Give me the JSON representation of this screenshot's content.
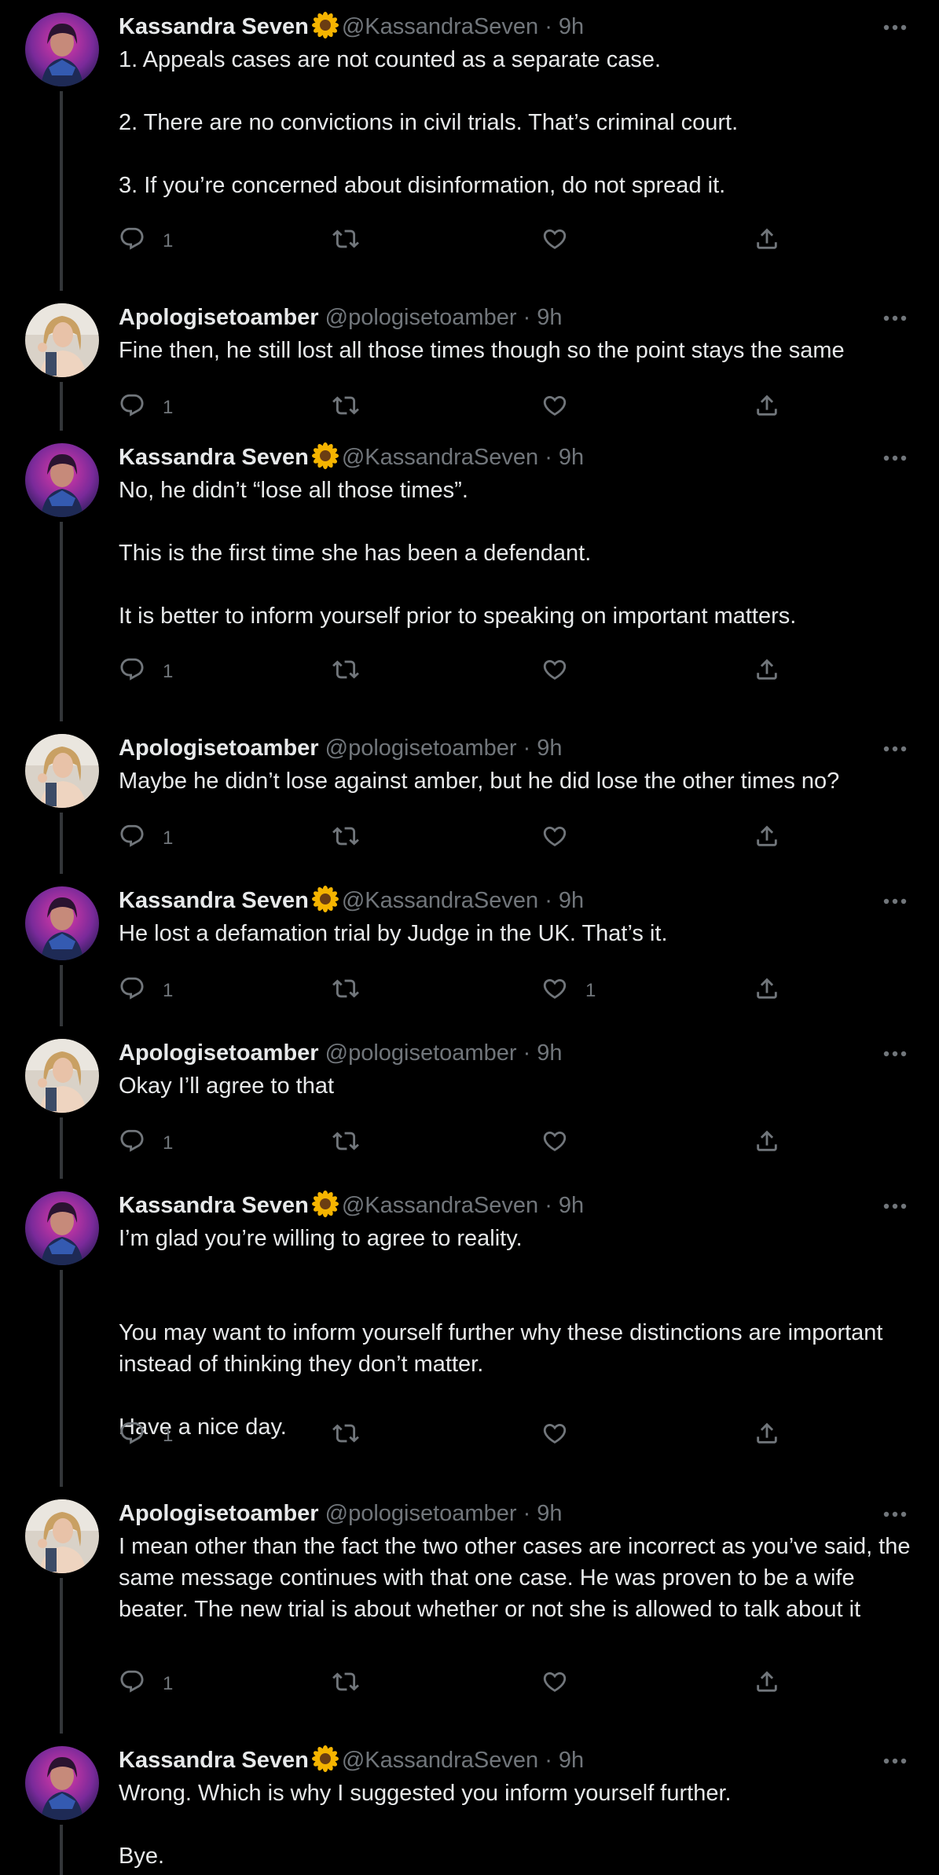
{
  "tweets": [
    {
      "author": "kassandra",
      "name": "Kassandra Seven",
      "handle": "@KassandraSeven",
      "time": "· 9h",
      "paragraphs": [
        "1. Appeals cases are not counted as a separate case.",
        "2. There are no convictions in civil trials. That’s criminal court.",
        "3. If you’re concerned about disinformation, do not spread it."
      ],
      "replies": "1",
      "retweets": "",
      "likes": ""
    },
    {
      "author": "apologise",
      "name": "Apologisetoamber",
      "handle": "@pologisetoamber",
      "time": "· 9h",
      "paragraphs": [
        "Fine then, he still lost all those times though so the point stays the same"
      ],
      "replies": "1",
      "retweets": "",
      "likes": ""
    },
    {
      "author": "kassandra",
      "name": "Kassandra Seven",
      "handle": "@KassandraSeven",
      "time": "· 9h",
      "paragraphs": [
        "No, he didn’t “lose all those times”.",
        "This is the first time she has been a defendant.",
        "It is better to inform yourself prior to speaking on important matters."
      ],
      "replies": "1",
      "retweets": "",
      "likes": ""
    },
    {
      "author": "apologise",
      "name": "Apologisetoamber",
      "handle": "@pologisetoamber",
      "time": "· 9h",
      "paragraphs": [
        "Maybe he didn’t lose against amber, but he did lose the other times no?"
      ],
      "replies": "1",
      "retweets": "",
      "likes": ""
    },
    {
      "author": "kassandra",
      "name": "Kassandra Seven",
      "handle": "@KassandraSeven",
      "time": "· 9h",
      "paragraphs": [
        "He lost a defamation trial by Judge in the UK. That’s it."
      ],
      "replies": "1",
      "retweets": "",
      "likes": "1"
    },
    {
      "author": "apologise",
      "name": "Apologisetoamber",
      "handle": "@pologisetoamber",
      "time": "· 9h",
      "paragraphs": [
        "Okay I’ll agree to that"
      ],
      "replies": "1",
      "retweets": "",
      "likes": ""
    },
    {
      "author": "kassandra",
      "name": "Kassandra Seven",
      "handle": "@KassandraSeven",
      "time": "· 9h",
      "paragraphs": [
        "I’m glad you’re willing to agree to reality.",
        "You may want to inform yourself further why these distinctions are important instead of thinking they don’t matter.",
        "Have a nice day."
      ],
      "replies": "1",
      "retweets": "",
      "likes": ""
    },
    {
      "author": "apologise",
      "name": "Apologisetoamber",
      "handle": "@pologisetoamber",
      "time": "· 9h",
      "paragraphs": [
        "I mean other than the fact the two other cases are incorrect as you’ve said, the same message continues with that one case. He was proven to be a wife beater. The new trial is about whether or not she is allowed to talk about it"
      ],
      "replies": "1",
      "retweets": "",
      "likes": ""
    },
    {
      "author": "kassandra",
      "name": "Kassandra Seven",
      "handle": "@KassandraSeven",
      "time": "· 9h",
      "paragraphs": [
        "Wrong. Which is why I suggested you inform yourself further.",
        "Bye."
      ],
      "replies": "",
      "retweets": "",
      "likes": ""
    }
  ],
  "icons": {
    "reply": "reply-icon",
    "retweet": "retweet-icon",
    "like": "heart-icon",
    "share": "share-icon",
    "more": "more-icon",
    "emoji": "sunflower-emoji"
  },
  "colors": {
    "background": "#000000",
    "text": "#e7e9ea",
    "muted": "#71767b",
    "thread_line": "#333639"
  }
}
